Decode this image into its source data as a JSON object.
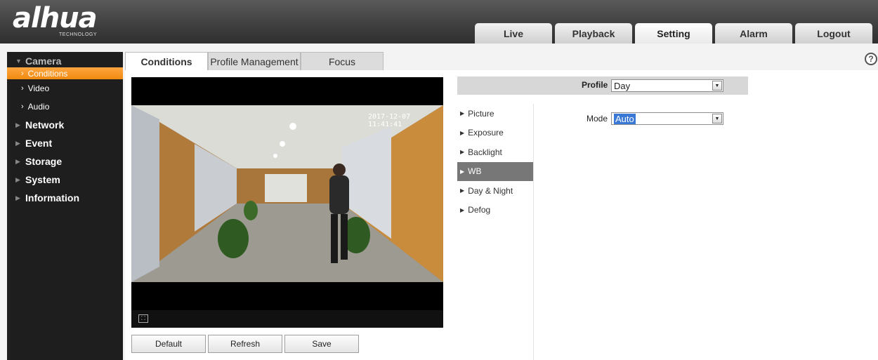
{
  "brand": {
    "logo_text": "alhua",
    "logo_sub": "TECHNOLOGY"
  },
  "nav_tabs": [
    {
      "label": "Live",
      "active": false
    },
    {
      "label": "Playback",
      "active": false
    },
    {
      "label": "Setting",
      "active": true
    },
    {
      "label": "Alarm",
      "active": false
    },
    {
      "label": "Logout",
      "active": false
    }
  ],
  "sidebar": {
    "camera": "Camera",
    "camera_subitems": [
      {
        "label": "Conditions",
        "active": true
      },
      {
        "label": "Video",
        "active": false
      },
      {
        "label": "Audio",
        "active": false
      }
    ],
    "sections": [
      "Network",
      "Event",
      "Storage",
      "System",
      "Information"
    ]
  },
  "content_tabs": [
    {
      "label": "Conditions",
      "active": true
    },
    {
      "label": "Profile Management",
      "active": false
    },
    {
      "label": "Focus",
      "active": false
    }
  ],
  "help_icon": "?",
  "video": {
    "timestamp": "2017-12-07 11:41:41",
    "fullscreen_icon": "fullscreen-icon"
  },
  "buttons": {
    "default": "Default",
    "refresh": "Refresh",
    "save": "Save"
  },
  "profile": {
    "label": "Profile",
    "value": "Day"
  },
  "settings_menu": [
    {
      "label": "Picture",
      "active": false
    },
    {
      "label": "Exposure",
      "active": false
    },
    {
      "label": "Backlight",
      "active": false
    },
    {
      "label": "WB",
      "active": true
    },
    {
      "label": "Day & Night",
      "active": false
    },
    {
      "label": "Defog",
      "active": false
    }
  ],
  "mode": {
    "label": "Mode",
    "value": "Auto"
  },
  "colors": {
    "accent": "#f08a10",
    "header_bg": "#3e3e3e",
    "sidebar_bg": "#1e1e1e",
    "selection": "#3a78d6"
  }
}
